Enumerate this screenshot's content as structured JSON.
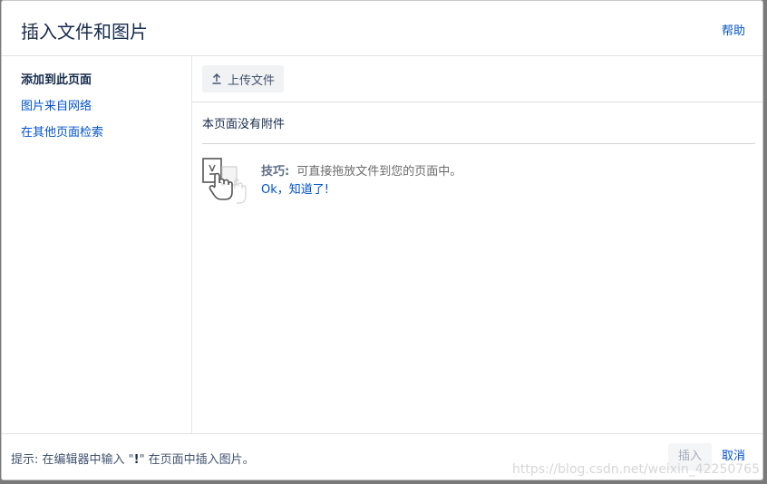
{
  "dialog": {
    "title": "插入文件和图片",
    "help_label": "帮助"
  },
  "sidebar": {
    "items": [
      {
        "label": "添加到此页面",
        "active": true
      },
      {
        "label": "图片来自网络",
        "active": false
      },
      {
        "label": "在其他页面检索",
        "active": false
      }
    ]
  },
  "main": {
    "upload_label": "上传文件",
    "upload_icon": "upload-arrow-icon",
    "empty_message": "本页面没有附件",
    "tip": {
      "label": "技巧:",
      "text": "可直接拖放文件到您的页面中。",
      "link": "Ok，知道了!",
      "icon": "drag-hand-icon"
    }
  },
  "footer": {
    "hint_prefix": "提示: 在编辑器中输入 \"",
    "hint_key": "!",
    "hint_suffix": "\" 在页面中插入图片。",
    "insert_label": "插入",
    "cancel_label": "取消"
  },
  "watermark": "https://blog.csdn.net/weixin_42250765"
}
